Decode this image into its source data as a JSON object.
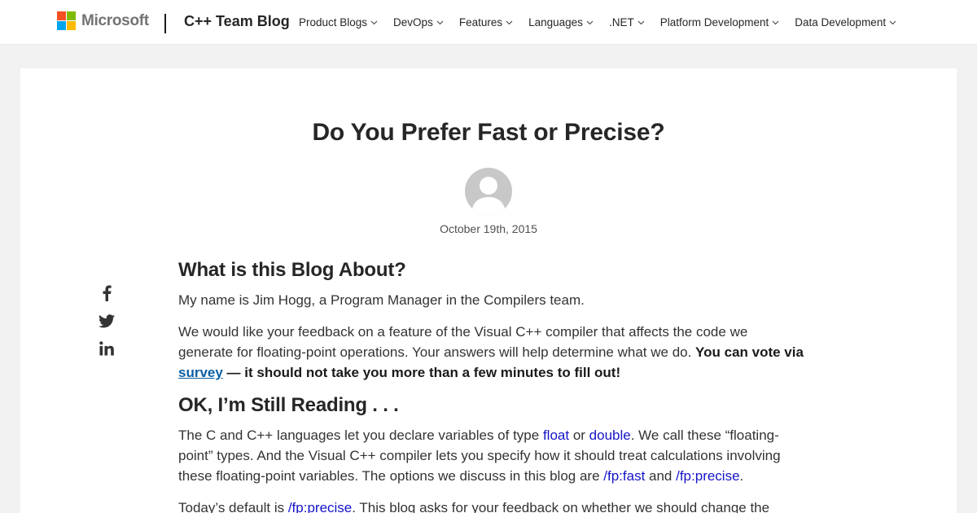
{
  "header": {
    "brand": "Microsoft",
    "site_title": "C++ Team Blog",
    "nav": [
      {
        "label": "Product Blogs"
      },
      {
        "label": "DevOps"
      },
      {
        "label": "Features"
      },
      {
        "label": "Languages"
      },
      {
        "label": ".NET"
      },
      {
        "label": "Platform Development"
      },
      {
        "label": "Data Development"
      }
    ]
  },
  "post": {
    "title": "Do You Prefer Fast or Precise?",
    "date": "October 19th, 2015",
    "sections": {
      "s1_heading": "What is this Blog About?",
      "s1_p1": "My name is Jim Hogg, a Program Manager in the Compilers team.",
      "s1_p2_a": "We would like your feedback on a feature of the Visual C++ compiler that affects the code we generate for floating-point operations. Your answers will help determine what we do. ",
      "s1_p2_bold_a": "You can vote via ",
      "s1_p2_link": "survey",
      "s1_p2_bold_b": " — it should not take you more than a few minutes to fill out!",
      "s2_heading": "OK, I’m Still Reading . . .",
      "s2_p1_a": "The C and C++ languages let you declare variables of type ",
      "s2_p1_code1": "float",
      "s2_p1_b": " or ",
      "s2_p1_code2": "double",
      "s2_p1_c": ". We call these “floating-point” types. And the Visual C++ compiler lets you specify how it should treat calculations involving these floating-point variables. The options we discuss in this blog are ",
      "s2_p1_code3": "/fp:fast",
      "s2_p1_d": " and ",
      "s2_p1_code4": "/fp:precise",
      "s2_p1_e": ".",
      "s2_p2_a": "Today’s default is ",
      "s2_p2_code": "/fp:precise",
      "s2_p2_b": ". This blog asks for your feedback on whether we should change the"
    }
  },
  "share": {
    "icons": [
      "facebook-icon",
      "twitter-icon",
      "linkedin-icon"
    ]
  },
  "colors": {
    "accent_link": "#0a5fa3",
    "code": "#1515c8",
    "background": "#f2f2f2"
  }
}
